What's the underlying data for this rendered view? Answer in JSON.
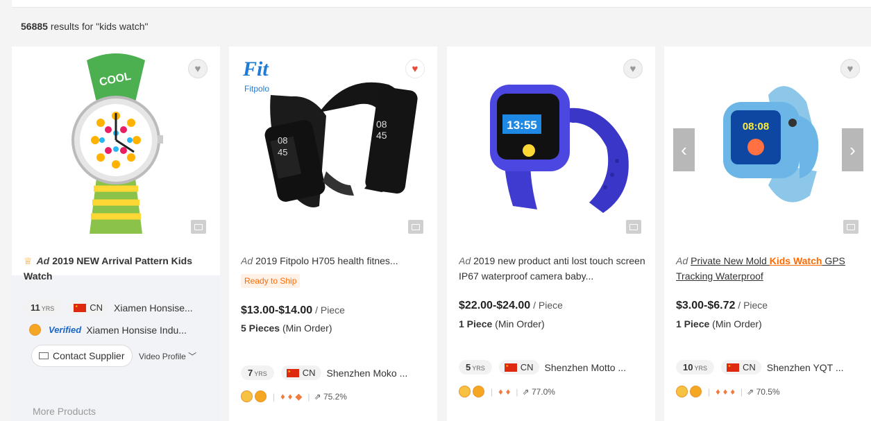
{
  "results": {
    "count": "56885",
    "text": " results for \"kids watch\""
  },
  "cards": [
    {
      "title": "2019 NEW Arrival Pattern Kids Watch",
      "ad": "Ad",
      "years": "11",
      "yrs_label": "YRS",
      "country": "CN",
      "supplier": "Xiamen Honsise...",
      "verified_label": "Verified",
      "verified_supplier": "Xiamen Honsise Indu...",
      "contact_label": "Contact Supplier",
      "video_profile": "Video Profile",
      "more": "More Products"
    },
    {
      "ad": "Ad",
      "title": "2019 Fitpolo H705 health fitnes...",
      "ready": "Ready to Ship",
      "price": "$13.00-$14.00",
      "unit": " / Piece",
      "moq_qty": "5 Pieces",
      "moq_label": " (Min Order)",
      "years": "7",
      "yrs_label": "YRS",
      "country": "CN",
      "supplier": "Shenzhen Moko ...",
      "rate": "75.2%",
      "brand": "Fitpolo"
    },
    {
      "ad": "Ad",
      "title": "2019 new product anti lost touch screen IP67 waterproof camera baby...",
      "price": "$22.00-$24.00",
      "unit": " / Piece",
      "moq_qty": "1 Piece",
      "moq_label": " (Min Order)",
      "years": "5",
      "yrs_label": "YRS",
      "country": "CN",
      "supplier": "Shenzhen Motto ...",
      "rate": "77.0%",
      "screen_time": "13:55"
    },
    {
      "ad": "Ad",
      "title_pre": "Private New Mold ",
      "title_kw": "Kids Watch",
      "title_post": " GPS Tracking Waterproof",
      "price": "$3.00-$6.72",
      "unit": " / Piece",
      "moq_qty": "1 Piece",
      "moq_label": " (Min Order)",
      "years": "10",
      "yrs_label": "YRS",
      "country": "CN",
      "supplier": "Shenzhen YQT ...",
      "rate": "70.5%",
      "screen_time": "08:08"
    }
  ]
}
